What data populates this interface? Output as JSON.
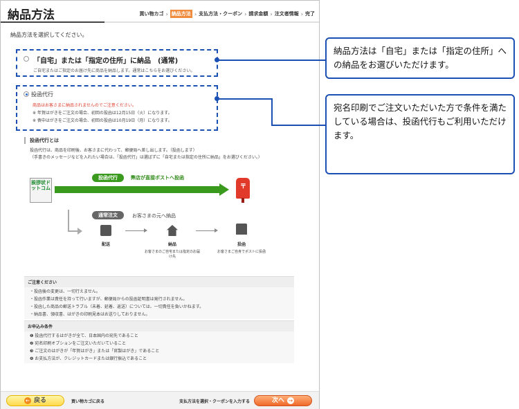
{
  "header": {
    "title": "納品方法",
    "steps": [
      "買い物カゴ",
      "納品方法",
      "支払方法・クーポン",
      "請求金額",
      "注文者情報",
      "完了"
    ],
    "current_step": "納品方法"
  },
  "intro": "納品方法を選択してください。",
  "options": {
    "home": {
      "title": "「自宅」または「指定の住所」に納品　(通常)",
      "sub": "ご自宅またはご指定のお届け先に商品を納品します。通常はこちらをお選びください。"
    },
    "post": {
      "title": "投函代行",
      "warning": "商品はお客さまに納品されませんのでご注意ください。",
      "note1": "※ 年賀はがきをご注文の場合、初回の投函は12月15日（火）になります。",
      "note2": "※ 喪中はがきをご注文の場合、初回の投函は10月19日（月）になります。"
    }
  },
  "about": {
    "heading": "投函代行とは",
    "text1": "投函代行は、商品を印刷後、お客さまに代わって、郵便局へ差し出します。（投函します）",
    "text2": "（手書きのメッセージなどを入れたい場合は、「投函代行」は選ばずに「自宅または指定の住所に納品」をお選びください。）"
  },
  "diagram": {
    "logo": "挨拶状ドットコム",
    "post_pill": "投函代行",
    "post_note": "弊店が直接ポストへ投函",
    "normal_pill": "通常注文",
    "normal_note": "お客さまの元へ納品",
    "step1": "配送",
    "step2": "納品",
    "step2_sub": "お客さまのご自宅または指定のお届け先",
    "step3": "投函",
    "step3_sub": "お客さまご自身でポストに投函"
  },
  "caution": {
    "heading": "ご注意ください",
    "lines": [
      "・投函後の変更は、一切行えません。",
      "・投函作業は責任を持って行いますが、郵便局からの投函証明書は発行されません。",
      "・投函した商品の郵送トラブル（未着、延着、返送）については、一切責任を負いかねます。",
      "・納品書、領収書、はがきの印刷見本はお送りしておりません。"
    ]
  },
  "conditions": {
    "heading": "お申込み条件",
    "lines": [
      "❶ 投函代行するはがきが全て、日本国内の宛先であること",
      "❷ 宛名印刷オプションをご注文いただいていること",
      "❸ ご注文のはがきが「年賀はがき」または「官製はがき」であること",
      "❹ お支払方法が、クレジットカードまたは銀行振込であること"
    ]
  },
  "footer": {
    "back_label": "戻る",
    "back_text": "買い物カゴに戻る",
    "next_text": "支払方法を選択・クーポンを入力する",
    "next_label": "次へ"
  },
  "callouts": {
    "c1": "納品方法は「自宅」または「指定の住所」への納品をお選びいただけます。",
    "c2": "宛名印刷でご注文いただいた方で条件を満たしている場合は、投函代行もご利用いただけます。"
  },
  "colors": {
    "accent": "#1a4fb3",
    "green": "#3a9a1e",
    "orange": "#f06a2a",
    "red": "#e03a2a"
  }
}
